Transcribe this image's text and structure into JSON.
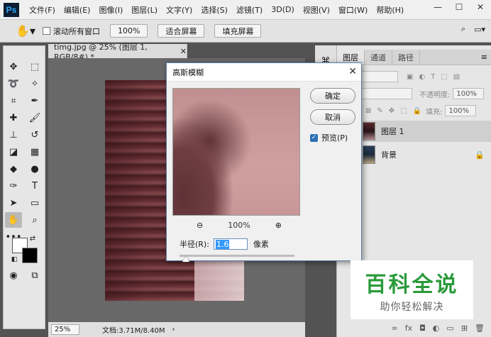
{
  "app": {
    "logo": "Ps"
  },
  "menu": [
    "文件(F)",
    "编辑(E)",
    "图像(I)",
    "图层(L)",
    "文字(Y)",
    "选择(S)",
    "滤镜(T)",
    "3D(D)",
    "视图(V)",
    "窗口(W)",
    "帮助(H)"
  ],
  "window_controls": [
    "—",
    "☐",
    "✕"
  ],
  "options": {
    "scroll_all_label": "滚动所有窗口",
    "zoom_value": "100%",
    "fit_screen": "适合屏幕",
    "fill_screen": "填充屏幕"
  },
  "document": {
    "tab_title": "timg.jpg @ 25% (图层 1, RGB/8#) *",
    "zoom": "25%",
    "doc_size": "文档:3.71M/8.40M"
  },
  "dialog": {
    "title": "高斯模糊",
    "ok": "确定",
    "cancel": "取消",
    "preview_label": "预览(P)",
    "preview_zoom": "100%",
    "radius_label": "半径(R):",
    "radius_value": "1.6",
    "radius_unit": "像素"
  },
  "layers_panel": {
    "tabs": [
      "图层",
      "通道",
      "路径"
    ],
    "opacity_label": "不透明度:",
    "opacity_value": "100%",
    "fill_label": "填充:",
    "fill_value": "100%",
    "layers": [
      {
        "name": "图层 1",
        "selected": true
      },
      {
        "name": "背景",
        "locked": true
      }
    ]
  },
  "watermark": {
    "title": "百科全说",
    "subtitle": "助你轻松解决"
  },
  "colors": {
    "accent": "#2f6fb8",
    "watermark_green": "#2a9a3a"
  }
}
